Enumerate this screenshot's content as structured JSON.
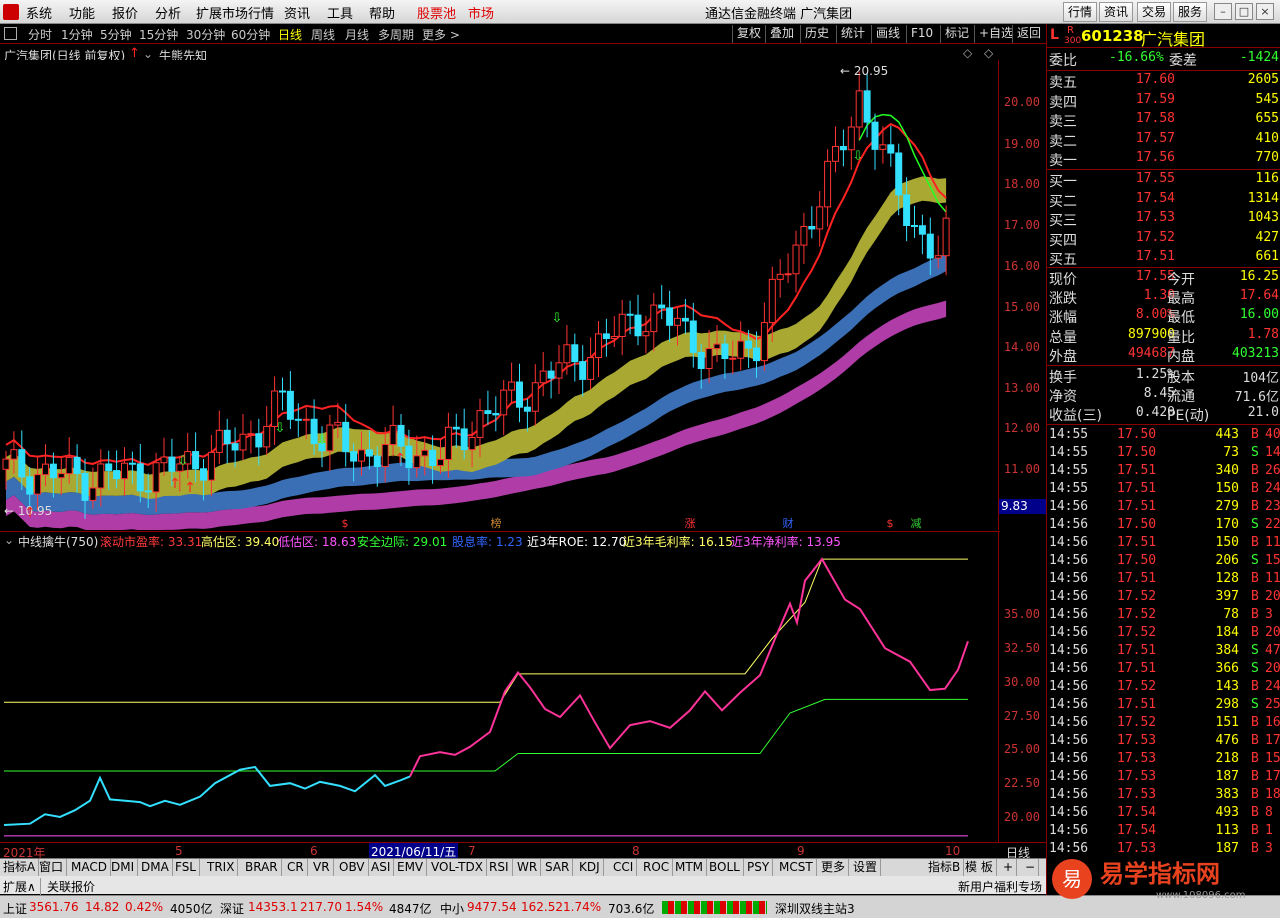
{
  "menu": {
    "items": [
      "系统",
      "功能",
      "报价",
      "分析",
      "扩展市场行情",
      "资讯",
      "工具",
      "帮助"
    ],
    "stockpool": "股票池",
    "market": "市场",
    "title": "通达信金融终端 广汽集团",
    "right_buttons": [
      "行情",
      "资讯",
      "交易",
      "服务"
    ]
  },
  "toolbar": {
    "periods": [
      "分时",
      "1分钟",
      "5分钟",
      "15分钟",
      "30分钟",
      "60分钟",
      "日线",
      "周线",
      "月线",
      "多周期",
      "更多 >"
    ],
    "selected": "日线",
    "right_buttons": [
      "复权",
      "叠加",
      "历史",
      "统计",
      "画线",
      "F10",
      "标记",
      "+自选",
      "返回"
    ]
  },
  "chart": {
    "title": "广汽集团(日线 前复权)",
    "indicator_name": "牛熊先知",
    "high_label": "20.95",
    "low_label": "10.95",
    "y_ticks": [
      "20.00",
      "19.00",
      "18.00",
      "17.00",
      "16.00",
      "15.00",
      "14.00",
      "13.00",
      "12.00",
      "11.00"
    ],
    "cursor_value": "9.83",
    "event_marks": [
      "$",
      "榜",
      "涨",
      "财",
      "$",
      "减"
    ]
  },
  "indicator": {
    "name": "中线擒牛(750)",
    "fields": [
      {
        "label": "滚动市盈率: 33.31",
        "color": "#ff3b3b"
      },
      {
        "label": "高估区: 39.40",
        "color": "#ffff66"
      },
      {
        "label": "低估区: 18.63",
        "color": "#ff55ff"
      },
      {
        "label": "安全边际: 29.01",
        "color": "#33ff33"
      },
      {
        "label": "股息率: 1.23",
        "color": "#3366ff"
      },
      {
        "label": "近3年ROE: 12.70",
        "color": "#ffffff"
      },
      {
        "label": "近3年毛利率: 16.15",
        "color": "#ffff66"
      },
      {
        "label": "近3年净利率: 13.95",
        "color": "#ff55ff"
      }
    ],
    "y_ticks": [
      "35.00",
      "32.50",
      "30.00",
      "27.50",
      "25.00",
      "22.50",
      "20.00"
    ]
  },
  "xaxis": {
    "labels": [
      "2021年",
      "5",
      "6",
      "7",
      "8",
      "9",
      "10"
    ],
    "cursor_date": "2021/06/11/五",
    "period": "日线"
  },
  "tabs": [
    "指标A",
    "窗口",
    "MACD",
    "DMI",
    "DMA",
    "FSL",
    "TRIX",
    "BRAR",
    "CR",
    "VR",
    "OBV",
    "ASI",
    "EMV",
    "VOL-TDX",
    "RSI",
    "WR",
    "SAR",
    "KDJ",
    "CCI",
    "ROC",
    "MTM",
    "BOLL",
    "PSY",
    "MCST",
    "更多",
    "设置"
  ],
  "tabs_right": [
    "指标B",
    "模 板",
    "+",
    "−"
  ],
  "extbar": {
    "left": [
      "扩展∧",
      "关联报价"
    ],
    "right": "新用户福利专场   福利专场福利专场"
  },
  "status": {
    "sh_name": "上证",
    "sh_val": "3561.76",
    "sh_chg": "14.82",
    "sh_pct": "0.42%",
    "sh_amt": "4050亿",
    "sz_name": "深证",
    "sz_val": "14353.1",
    "sz_chg": "217.70",
    "sz_pct": "1.54%",
    "sz_amt": "4847亿",
    "zx_name": "中小",
    "zx_val": "9477.54",
    "zx_chg": "162.52",
    "zx_pct": "1.74%",
    "zx_amt": "703.6亿",
    "site": "深圳双线主站3"
  },
  "quote": {
    "code": "601238",
    "name": "广汽集团",
    "badge_l": "L",
    "badge_r": "R",
    "badge_sub": "300",
    "weibi": {
      "label": "委比",
      "val": "-16.66%",
      "label2": "委差",
      "val2": "-1424"
    },
    "asks": [
      {
        "label": "卖五",
        "price": "17.60",
        "vol": "2605"
      },
      {
        "label": "卖四",
        "price": "17.59",
        "vol": "545"
      },
      {
        "label": "卖三",
        "price": "17.58",
        "vol": "655"
      },
      {
        "label": "卖二",
        "price": "17.57",
        "vol": "410"
      },
      {
        "label": "卖一",
        "price": "17.56",
        "vol": "770"
      }
    ],
    "bids": [
      {
        "label": "买一",
        "price": "17.55",
        "vol": "116"
      },
      {
        "label": "买二",
        "price": "17.54",
        "vol": "1314"
      },
      {
        "label": "买三",
        "price": "17.53",
        "vol": "1043"
      },
      {
        "label": "买四",
        "price": "17.52",
        "vol": "427"
      },
      {
        "label": "买五",
        "price": "17.51",
        "vol": "661"
      }
    ],
    "stats": [
      {
        "l1": "现价",
        "v1": "17.55",
        "l2": "今开",
        "v2": "16.25"
      },
      {
        "l1": "涨跌",
        "v1": "1.30",
        "l2": "最高",
        "v2": "17.64"
      },
      {
        "l1": "涨幅",
        "v1": "8.00%",
        "l2": "最低",
        "v2": "16.00"
      },
      {
        "l1": "总量",
        "v1": "897900",
        "l2": "量比",
        "v2": "1.78"
      },
      {
        "l1": "外盘",
        "v1": "494687",
        "l2": "内盘",
        "v2": "403213"
      }
    ],
    "stats2": [
      {
        "l1": "换手",
        "v1": "1.25%",
        "l2": "股本",
        "v2": "104亿"
      },
      {
        "l1": "净资",
        "v1": "8.45",
        "l2": "流通",
        "v2": "71.6亿"
      },
      {
        "l1": "收益(三)",
        "v1": "0.420",
        "l2": "PE(动)",
        "v2": "21.0"
      }
    ],
    "ticks": [
      [
        "14:55",
        "17.50",
        "443",
        "B",
        "40"
      ],
      [
        "14:55",
        "17.50",
        "73",
        "S",
        "14"
      ],
      [
        "14:55",
        "17.51",
        "340",
        "B",
        "26"
      ],
      [
        "14:55",
        "17.51",
        "150",
        "B",
        "24"
      ],
      [
        "14:56",
        "17.51",
        "279",
        "B",
        "23"
      ],
      [
        "14:56",
        "17.50",
        "170",
        "S",
        "22"
      ],
      [
        "14:56",
        "17.51",
        "150",
        "B",
        "11"
      ],
      [
        "14:56",
        "17.50",
        "206",
        "S",
        "15"
      ],
      [
        "14:56",
        "17.51",
        "128",
        "B",
        "11"
      ],
      [
        "14:56",
        "17.52",
        "397",
        "B",
        "20"
      ],
      [
        "14:56",
        "17.52",
        "78",
        "B",
        "3"
      ],
      [
        "14:56",
        "17.52",
        "184",
        "B",
        "20"
      ],
      [
        "14:56",
        "17.51",
        "384",
        "S",
        "47"
      ],
      [
        "14:56",
        "17.51",
        "366",
        "S",
        "20"
      ],
      [
        "14:56",
        "17.52",
        "143",
        "B",
        "24"
      ],
      [
        "14:56",
        "17.51",
        "298",
        "S",
        "25"
      ],
      [
        "14:56",
        "17.52",
        "151",
        "B",
        "16"
      ],
      [
        "14:56",
        "17.53",
        "476",
        "B",
        "17"
      ],
      [
        "14:56",
        "17.53",
        "218",
        "B",
        "15"
      ],
      [
        "14:56",
        "17.53",
        "187",
        "B",
        "17"
      ],
      [
        "14:56",
        "17.53",
        "383",
        "B",
        "18"
      ],
      [
        "14:56",
        "17.54",
        "493",
        "B",
        "8"
      ],
      [
        "14:56",
        "17.54",
        "113",
        "B",
        "1"
      ],
      [
        "14:56",
        "17.53",
        "187",
        "B",
        "3"
      ]
    ]
  },
  "watermark": {
    "text": "易学指标网",
    "url": "www.108096.com"
  }
}
